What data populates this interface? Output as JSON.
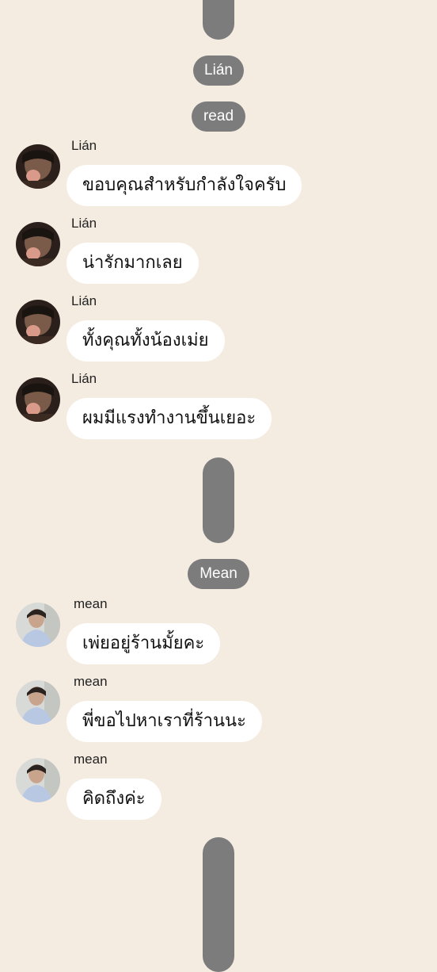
{
  "colors": {
    "background": "#f4ece1",
    "pill": "#7c7c7c",
    "bubble": "#ffffff"
  },
  "pills": {
    "lian": "Lián",
    "read": "read",
    "mean": "Mean"
  },
  "messages_lian": [
    {
      "sender": "Lián",
      "text": "ขอบคุณสำหรับกำลังใจครับ"
    },
    {
      "sender": "Lián",
      "text": "น่ารักมากเลย"
    },
    {
      "sender": "Lián",
      "text": "ทั้งคุณทั้งน้องเม่ย"
    },
    {
      "sender": "Lián",
      "text": "ผมมีแรงทำงานขึ้นเยอะ"
    }
  ],
  "messages_mean": [
    {
      "sender": "mean",
      "text": "เพ่ยอยู่ร้านมั้ยคะ"
    },
    {
      "sender": "mean",
      "text": "พี่ขอไปหาเราที่ร้านนะ"
    },
    {
      "sender": "mean",
      "text": "คิดถึงค่ะ"
    }
  ]
}
